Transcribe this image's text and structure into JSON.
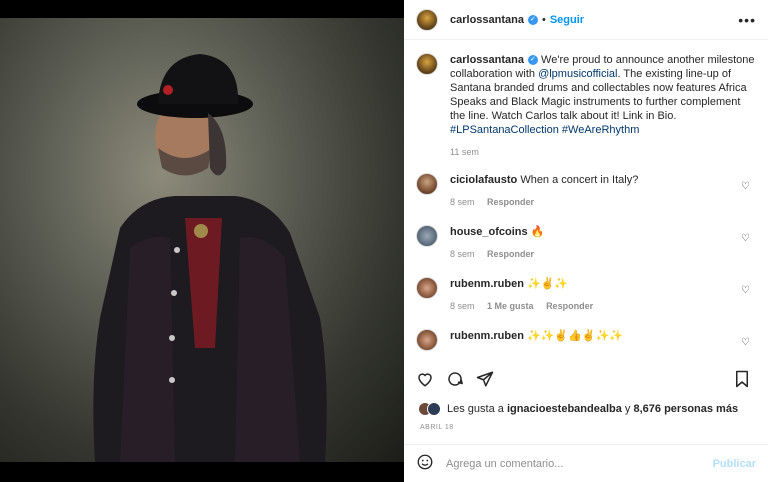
{
  "header": {
    "username": "carlossantana",
    "separator": "•",
    "follow_label": "Seguir",
    "more_label": "•••"
  },
  "caption": {
    "username": "carlossantana",
    "text_part1": "We're proud to announce another milestone collaboration with ",
    "mention": "@lpmusicofficial",
    "text_part2": ". The existing line-up of Santana branded drums and collectables now features Africa Speaks and Black Magic instruments to further complement the line. Watch Carlos talk about it! Link in Bio.",
    "hashtag1": "#LPSantanaCollection",
    "hashtag2": "#WeAreRhythm",
    "time": "11 sem"
  },
  "comments": [
    {
      "username": "ciciolafausto",
      "text": "When a concert in Italy?",
      "time": "8 sem",
      "likes": "",
      "reply": "Responder"
    },
    {
      "username": "house_ofcoins",
      "text": "🔥",
      "time": "8 sem",
      "likes": "",
      "reply": "Responder"
    },
    {
      "username": "rubenm.ruben",
      "text": "✨✌️✨",
      "time": "8 sem",
      "likes": "1 Me gusta",
      "reply": "Responder"
    },
    {
      "username": "rubenm.ruben",
      "text": "✨✨✌️👍✌️✨✨",
      "time": "",
      "likes": "",
      "reply": ""
    }
  ],
  "likes": {
    "prefix": "Les gusta a ",
    "user": "ignacioestebandealba",
    "middle": " y ",
    "count": "8,676 personas más"
  },
  "date": "ABRIL 18",
  "add_comment": {
    "placeholder": "Agrega un comentario...",
    "publish_label": "Publicar"
  },
  "colors": {
    "accent": "#0095f6",
    "publish_disabled": "#b2dffc",
    "text": "#262626",
    "muted": "#8e8e8e"
  }
}
